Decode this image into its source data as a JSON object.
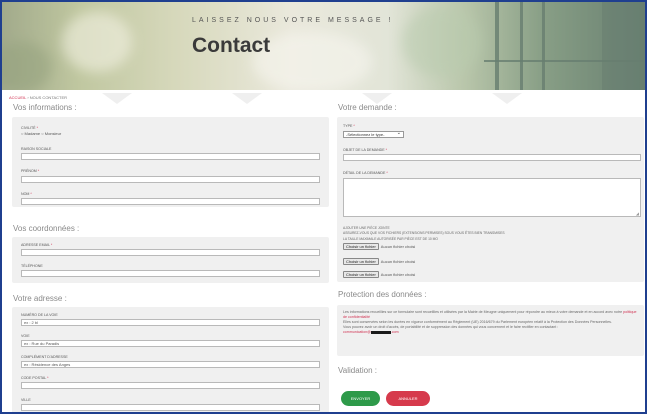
{
  "hero": {
    "subtitle": "LAISSEZ NOUS VOTRE MESSAGE !",
    "title": "Contact"
  },
  "breadcrumb": {
    "home": "ACCUEIL",
    "sep": " › ",
    "current": "NOUS CONTACTER"
  },
  "left": {
    "infos": {
      "heading": "Vos informations :",
      "civilite": {
        "label": "CIVILITÉ",
        "req": "*",
        "opt1": "Madame",
        "opt2": "Monsieur"
      },
      "raison": {
        "label": "RAISON SOCIALE"
      },
      "prenom": {
        "label": "PRÉNOM",
        "req": "*"
      },
      "nom": {
        "label": "NOM",
        "req": "*"
      }
    },
    "coords": {
      "heading": "Vos coordonnées :",
      "email": {
        "label": "ADRESSE EMAIL",
        "req": "*"
      },
      "tel": {
        "label": "TÉLÉPHONE"
      }
    },
    "adresse": {
      "heading": "Votre adresse :",
      "numero": {
        "label": "NUMÉRO DE LA VOIE",
        "value": "ex : 2 bl"
      },
      "voie": {
        "label": "VOIE",
        "value": "ex : Rue du Paradis"
      },
      "complement": {
        "label": "COMPLÉMENT D'ADRESSE",
        "value": "ex : Résidence des Anges"
      },
      "cp": {
        "label": "CODE POSTAL",
        "req": "*"
      },
      "ville": {
        "label": "VILLE"
      }
    }
  },
  "right": {
    "demande": {
      "heading": "Votre demande :",
      "type": {
        "label": "TYPE",
        "req": "*",
        "value": "-Sélectionnez le type-"
      },
      "objet": {
        "label": "OBJET DE LA DEMANDE",
        "req": "*"
      },
      "detail": {
        "label": "DÉTAIL DE LA DEMANDE",
        "req": "*"
      },
      "pj": {
        "line1": "AJOUTER UNE PIÈCE JOINTE",
        "line2": "ASSUREZ-VOUS QUE VOS FICHIERS (EXTENSIONS PERMISES) SOUS VOUS ÊTES BIEN TRANSMISES",
        "line3": "LA TAILLE MAXIMALE AUTORISÉE PAR PIÈCE EST DE 10 MO",
        "button": "Choisir un fichier",
        "none": "Aucun fichier choisi"
      }
    },
    "protection": {
      "heading": "Protection des données :",
      "p1": "Les informations recueillies sur ce formulaire sont recueillies et utilisées par la Mairie de Meugne uniquement pour répondre au mieux à votre demande et en accord avec notre",
      "p1link": "politique de confidentialité",
      "p2": "Elles sont conservées selon les durées en vigueur conformément au Règlement (UE) 2016/679 du Parlement européen relatif à la Protection des Données Personnelles.",
      "p3": "Vous pouvez avoir un droit d'accès, de portabilité et de suppression des données qui vous concernent et le faire rectifier en contactant :",
      "email_pre": "communication@",
      "email_post": ".com"
    },
    "validation": {
      "heading": "Validation :",
      "submit": "ENVOYER",
      "cancel": "ANNULER"
    }
  },
  "colors": {
    "accent": "#d03050",
    "submit": "#2e9a4a",
    "cancel": "#d63a4c",
    "frame": "#1f3f8f"
  }
}
